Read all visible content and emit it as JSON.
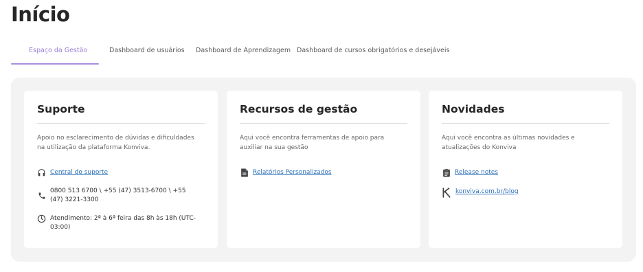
{
  "page": {
    "title": "Início"
  },
  "tabs": [
    {
      "label": "Espaço da Gestão",
      "active": true
    },
    {
      "label": "Dashboard de usuários",
      "active": false
    },
    {
      "label": "Dashboard de Aprendizagem",
      "active": false
    },
    {
      "label": "Dashboard de cursos obrigatórios e desejáveis",
      "active": false
    }
  ],
  "colors": {
    "accent": "#a88de0",
    "link": "#2a6fb8",
    "panel_bg": "#f3f3f3"
  },
  "cards": {
    "suporte": {
      "title": "Suporte",
      "description": "Apoio no esclarecimento de dúvidas e dificuldades na utilização da plataforma Konviva.",
      "items": [
        {
          "icon": "headset-icon",
          "text": "Central do suporte",
          "link": true
        },
        {
          "icon": "phone-icon",
          "text": "0800 513 6700 \\ +55 (47) 3513-6700 \\ +55 (47) 3221-3300",
          "link": false
        },
        {
          "icon": "clock-icon",
          "text": "Atendimento: 2ª à 6ª feira das 8h às 18h (UTC-03:00)",
          "link": false
        }
      ]
    },
    "recursos": {
      "title": "Recursos de gestão",
      "description": "Aqui você encontra ferramentas de apoio para auxiliar na sua gestão",
      "items": [
        {
          "icon": "document-icon",
          "text": "Relatórios Personalizados",
          "link": true
        }
      ]
    },
    "novidades": {
      "title": "Novidades",
      "description": "Aqui você encontra as últimas novidades e atualizações do Konviva",
      "items": [
        {
          "icon": "clipboard-icon",
          "text": "Release notes",
          "link": true
        },
        {
          "icon": "konviva-logo-icon",
          "text": "konviva.com.br/blog",
          "link": true
        }
      ]
    }
  }
}
